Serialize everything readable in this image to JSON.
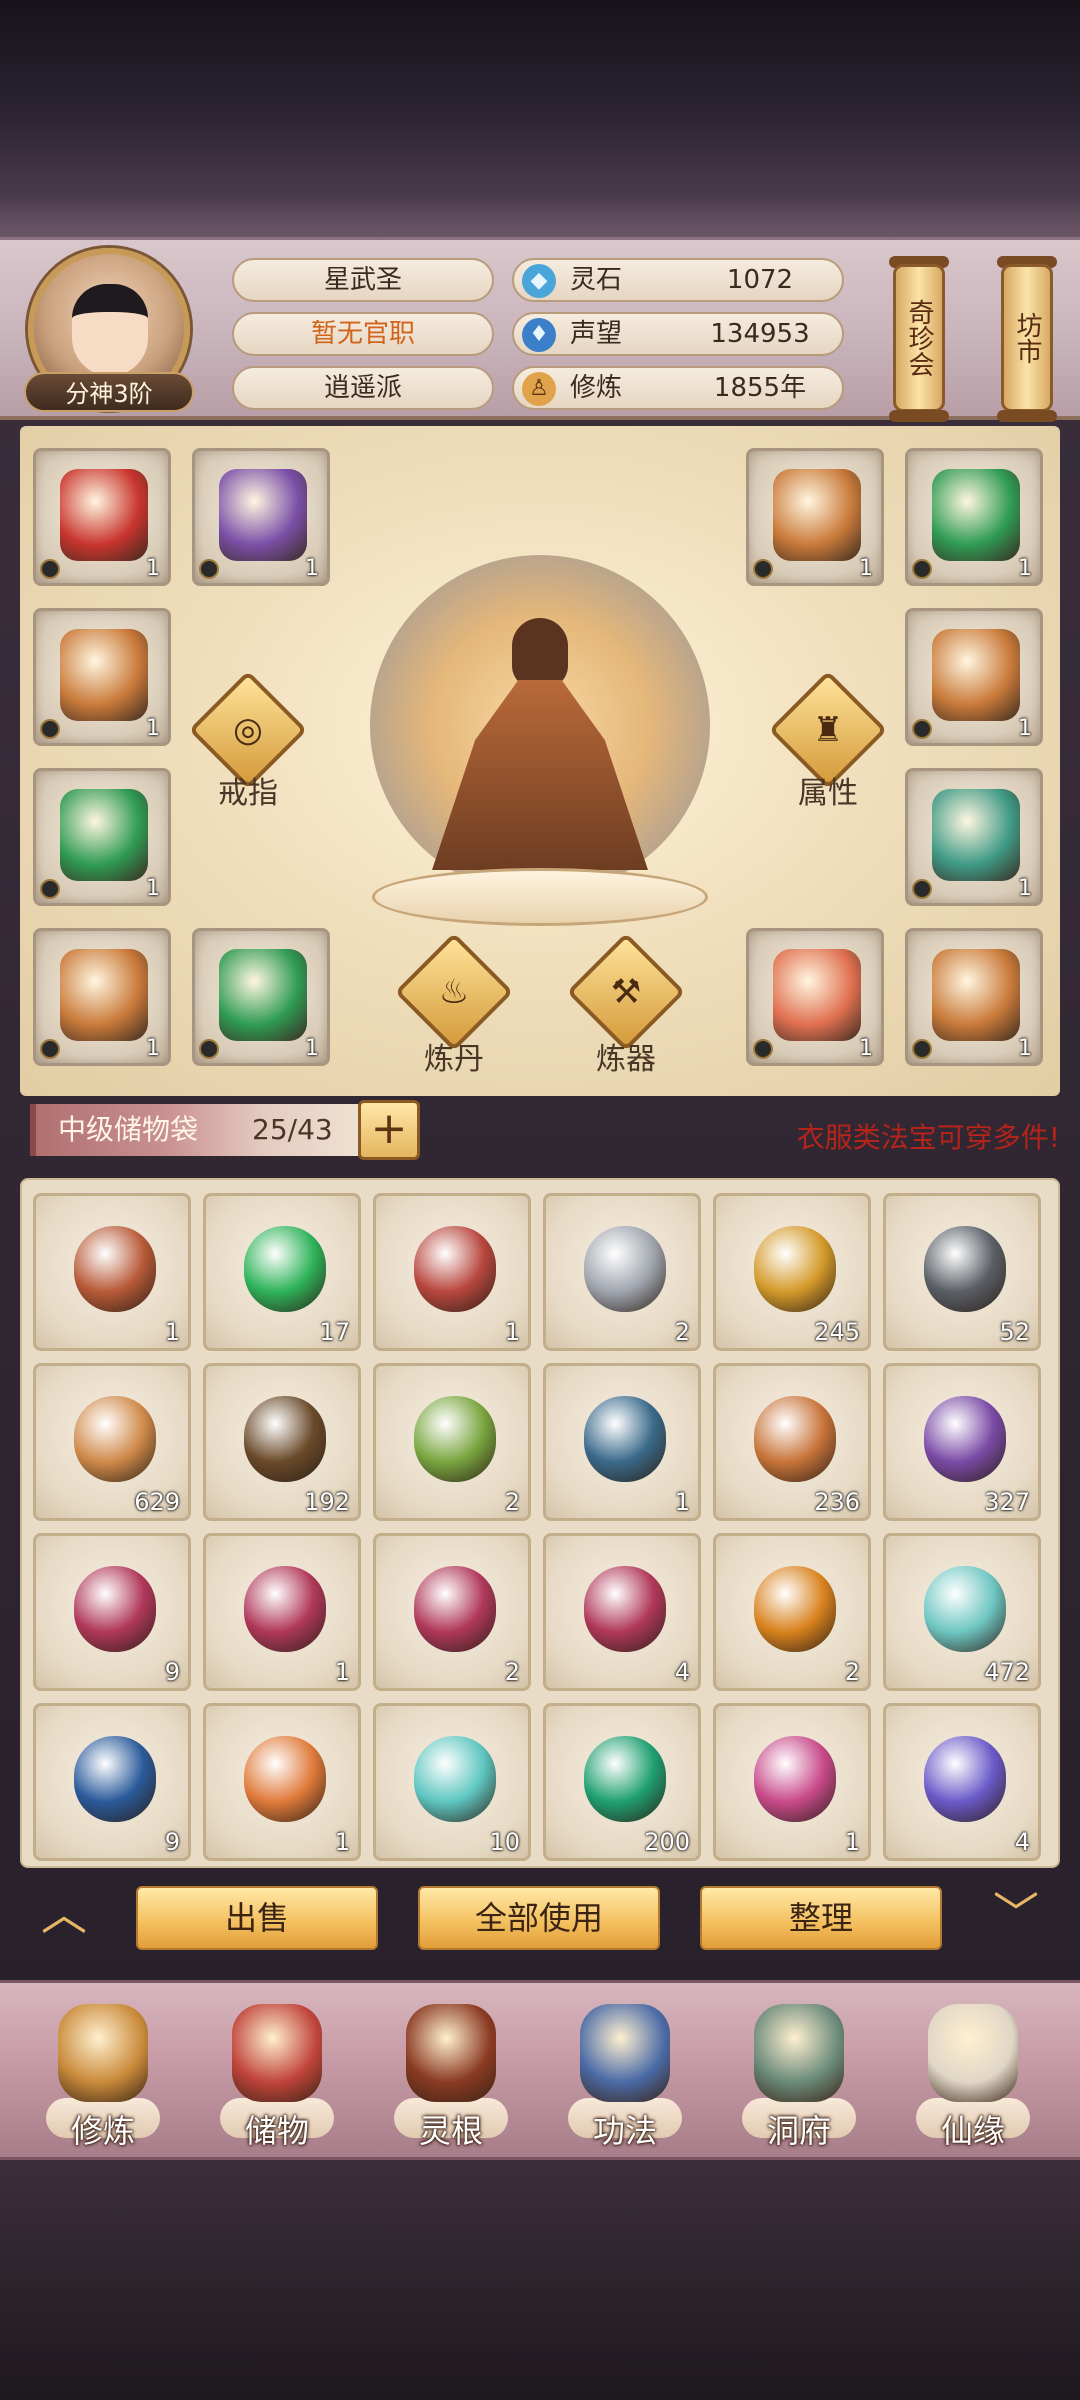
{
  "colors": {
    "accent": "#f3be5c",
    "warning_text": "#b4241a",
    "rank_tag_text": "#fff3dd",
    "title_orange": "#d2641a"
  },
  "header": {
    "rank_tag": "分神3阶",
    "info": [
      "星武圣",
      "暂无官职",
      "逍遥派"
    ],
    "stats": [
      {
        "icon": "spirit-stone-icon",
        "glyph": "◆",
        "label": "灵石",
        "value": "1072"
      },
      {
        "icon": "prestige-icon",
        "glyph": "♦",
        "label": "声望",
        "value": "134953"
      },
      {
        "icon": "cultivate-icon",
        "glyph": "♙",
        "label": "修炼",
        "value": "1855年"
      }
    ],
    "scroll_buttons": [
      "奇珍会",
      "坊市"
    ]
  },
  "equipment": {
    "slots": [
      {
        "name": "weapon-slot",
        "color": "#c9352e",
        "count": "1"
      },
      {
        "name": "robe-slot",
        "color": "#7b4fa8",
        "count": "1"
      },
      {
        "name": "armor-slot-1",
        "color": "#c97a3a",
        "count": "1"
      },
      {
        "name": "armor-slot-2",
        "color": "#2f9b54",
        "count": "1"
      },
      {
        "name": "armor-slot-3",
        "color": "#c97a3a",
        "count": "1"
      },
      {
        "name": "armor-slot-4",
        "color": "#c97a3a",
        "count": "1"
      },
      {
        "name": "armor-slot-5",
        "color": "#2f9b54",
        "count": "1"
      },
      {
        "name": "armor-slot-6",
        "color": "#3f9a86",
        "count": "1"
      },
      {
        "name": "armor-slot-7",
        "color": "#c97a3a",
        "count": "1"
      },
      {
        "name": "armor-slot-8",
        "color": "#2f9b54",
        "count": "1"
      },
      {
        "name": "dragon-slot",
        "color": "#e07050",
        "count": "1"
      },
      {
        "name": "armor-slot-9",
        "color": "#c97a3a",
        "count": "1"
      }
    ],
    "functions": {
      "ring": {
        "label": "戒指",
        "glyph": "◎"
      },
      "attributes": {
        "label": "属性",
        "glyph": "♜"
      },
      "alchemy": {
        "label": "炼丹",
        "glyph": "♨"
      },
      "forging": {
        "label": "炼器",
        "glyph": "⚒"
      }
    }
  },
  "bag": {
    "name": "中级储物袋",
    "count": "25/43",
    "add_glyph": "+",
    "note": "衣服类法宝可穿多件!",
    "items": [
      {
        "name": "ring",
        "color": "#b85a38",
        "count": "1"
      },
      {
        "name": "green-orb",
        "color": "#2fb35a",
        "count": "17"
      },
      {
        "name": "red-orb",
        "color": "#b8473e",
        "count": "1"
      },
      {
        "name": "silver-ore",
        "color": "#9fa4ad",
        "count": "2"
      },
      {
        "name": "gold-ore",
        "color": "#d49a2a",
        "count": "245"
      },
      {
        "name": "dark-ore",
        "color": "#5a5f66",
        "count": "52"
      },
      {
        "name": "ginseng",
        "color": "#d08a4a",
        "count": "629"
      },
      {
        "name": "root-herb",
        "color": "#6a4a2a",
        "count": "192"
      },
      {
        "name": "flower-herb",
        "color": "#7aa640",
        "count": "2"
      },
      {
        "name": "berry-branch",
        "color": "#3a6a8a",
        "count": "1"
      },
      {
        "name": "cordyceps",
        "color": "#c8743a",
        "count": "236"
      },
      {
        "name": "grape-herb",
        "color": "#7a4aa6",
        "count": "327"
      },
      {
        "name": "elixir-flask-1",
        "color": "#b0385a",
        "count": "9"
      },
      {
        "name": "elixir-flask-2",
        "color": "#b0385a",
        "count": "1"
      },
      {
        "name": "elixir-flask-3",
        "color": "#b0385a",
        "count": "2"
      },
      {
        "name": "elixir-flask-4",
        "color": "#b0385a",
        "count": "4"
      },
      {
        "name": "gourd",
        "color": "#d9821e",
        "count": "2"
      },
      {
        "name": "jade-vase",
        "color": "#6ec6c2",
        "count": "472"
      },
      {
        "name": "star-disk",
        "color": "#2a5a9a",
        "count": "9"
      },
      {
        "name": "beast-egg",
        "color": "#e07a3a",
        "count": "1"
      },
      {
        "name": "cloud-bead",
        "color": "#5ec6c0",
        "count": "10"
      },
      {
        "name": "emerald",
        "color": "#1fa071",
        "count": "200"
      },
      {
        "name": "scroll",
        "color": "#c84a8a",
        "count": "1"
      },
      {
        "name": "talisman",
        "color": "#6a5ac8",
        "count": "4"
      }
    ]
  },
  "actions": {
    "sell": "出售",
    "use_all": "全部使用",
    "sort": "整理",
    "up_arrow": "︿",
    "down_arrow": "﹀"
  },
  "nav": [
    {
      "label": "修炼",
      "icon": "cultivation-icon",
      "color": "#c98a3a"
    },
    {
      "label": "储物",
      "icon": "storage-bag-icon",
      "color": "#c0443a"
    },
    {
      "label": "灵根",
      "icon": "spirit-root-icon",
      "color": "#8a3a22"
    },
    {
      "label": "功法",
      "icon": "technique-book-icon",
      "color": "#4a6aa6"
    },
    {
      "label": "洞府",
      "icon": "cave-mansion-icon",
      "color": "#6a8a7a"
    },
    {
      "label": "仙缘",
      "icon": "immortal-fate-icon",
      "color": "#e0d6c6"
    }
  ]
}
